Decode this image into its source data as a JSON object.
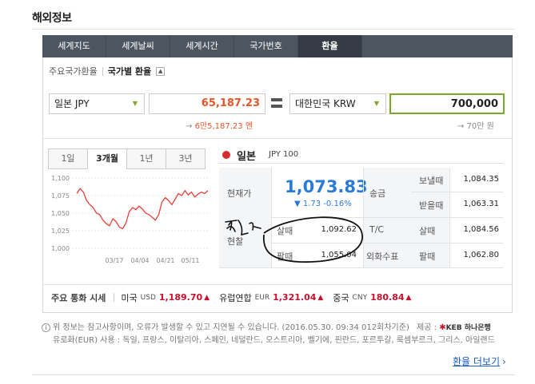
{
  "header": {
    "title": "해외정보"
  },
  "tabs": [
    {
      "label": "세계지도"
    },
    {
      "label": "세계날씨"
    },
    {
      "label": "세계시간"
    },
    {
      "label": "국가번호"
    },
    {
      "label": "환율"
    }
  ],
  "subnav": {
    "item1": "주요국가환율",
    "item2": "국가별 환율"
  },
  "converter": {
    "from_currency": "일본 JPY",
    "from_amount": "65,187.23",
    "to_currency": "대한민국 KRW",
    "to_amount": "700,000",
    "from_hint": "6만5,187.23 엔",
    "to_hint": "70만 원"
  },
  "period_tabs": [
    {
      "label": "1일"
    },
    {
      "label": "3개월"
    },
    {
      "label": "1년"
    },
    {
      "label": "3년"
    }
  ],
  "chart_data": {
    "type": "line",
    "x_tick_labels": [
      "03/17",
      "04/04",
      "04/21",
      "05/11"
    ],
    "y_tick_labels": [
      "1,100",
      "1,075",
      "1,050",
      "1,025",
      "1,000"
    ],
    "ylim": [
      1000,
      1100
    ],
    "values": [
      1078,
      1085,
      1080,
      1068,
      1062,
      1058,
      1050,
      1048,
      1040,
      1035,
      1032,
      1042,
      1038,
      1030,
      1028,
      1036,
      1052,
      1058,
      1055,
      1060,
      1056,
      1050,
      1048,
      1044,
      1040,
      1048,
      1066,
      1072,
      1068,
      1062,
      1070,
      1078,
      1075,
      1082,
      1076,
      1080,
      1073,
      1077,
      1080,
      1078,
      1082
    ]
  },
  "info": {
    "country": "일본",
    "code": "JPY 100",
    "current_label": "현재가",
    "current_rate": "1,073.83",
    "change": "▼ 1.73 -0.16%",
    "cash_label": "현찰",
    "cash_buy_label": "살때",
    "cash_buy": "1,092.62",
    "cash_sell_label": "팔때",
    "cash_sell": "1,055.04",
    "remit_label": "송금",
    "remit_send_label": "보낼때",
    "remit_send": "1,084.35",
    "remit_recv_label": "받을때",
    "remit_recv": "1,063.31",
    "tc_label": "T/C",
    "tc_buy_label": "살때",
    "tc_buy": "1,084.56",
    "foreign_label": "외화수표",
    "foreign_sell_label": "팔때",
    "foreign_sell": "1,062.80"
  },
  "summary": {
    "label": "주요 통화 시세",
    "items": [
      {
        "name": "미국",
        "code": "USD",
        "value": "1,189.70",
        "dir": "▲"
      },
      {
        "name": "유럽연합",
        "code": "EUR",
        "value": "1,321.04",
        "dir": "▲"
      },
      {
        "name": "중국",
        "code": "CNY",
        "value": "180.84",
        "dir": "▲"
      }
    ]
  },
  "notice": {
    "line1": "위 정보는 참고사항이며, 오류가 발생할 수 있고 지연될 수 있습니다. (2016.05.30. 09:34 012회차기준)",
    "provider_label": "제공 :",
    "provider": "KEB 하나은행",
    "line2": "유로화(EUR) 사용 : 독일, 프랑스, 이탈리아, 스페인, 네덜란드, 오스트리아, 벨기에, 핀란드, 포르투갈, 룩셈부르크, 그리스, 아일랜드"
  },
  "more_link": "환율 더보기",
  "colors": {
    "accent_green": "#7ca82a",
    "rate_blue": "#2a7bd8",
    "up_red": "#c8102e",
    "chart_red": "#e8403a"
  }
}
